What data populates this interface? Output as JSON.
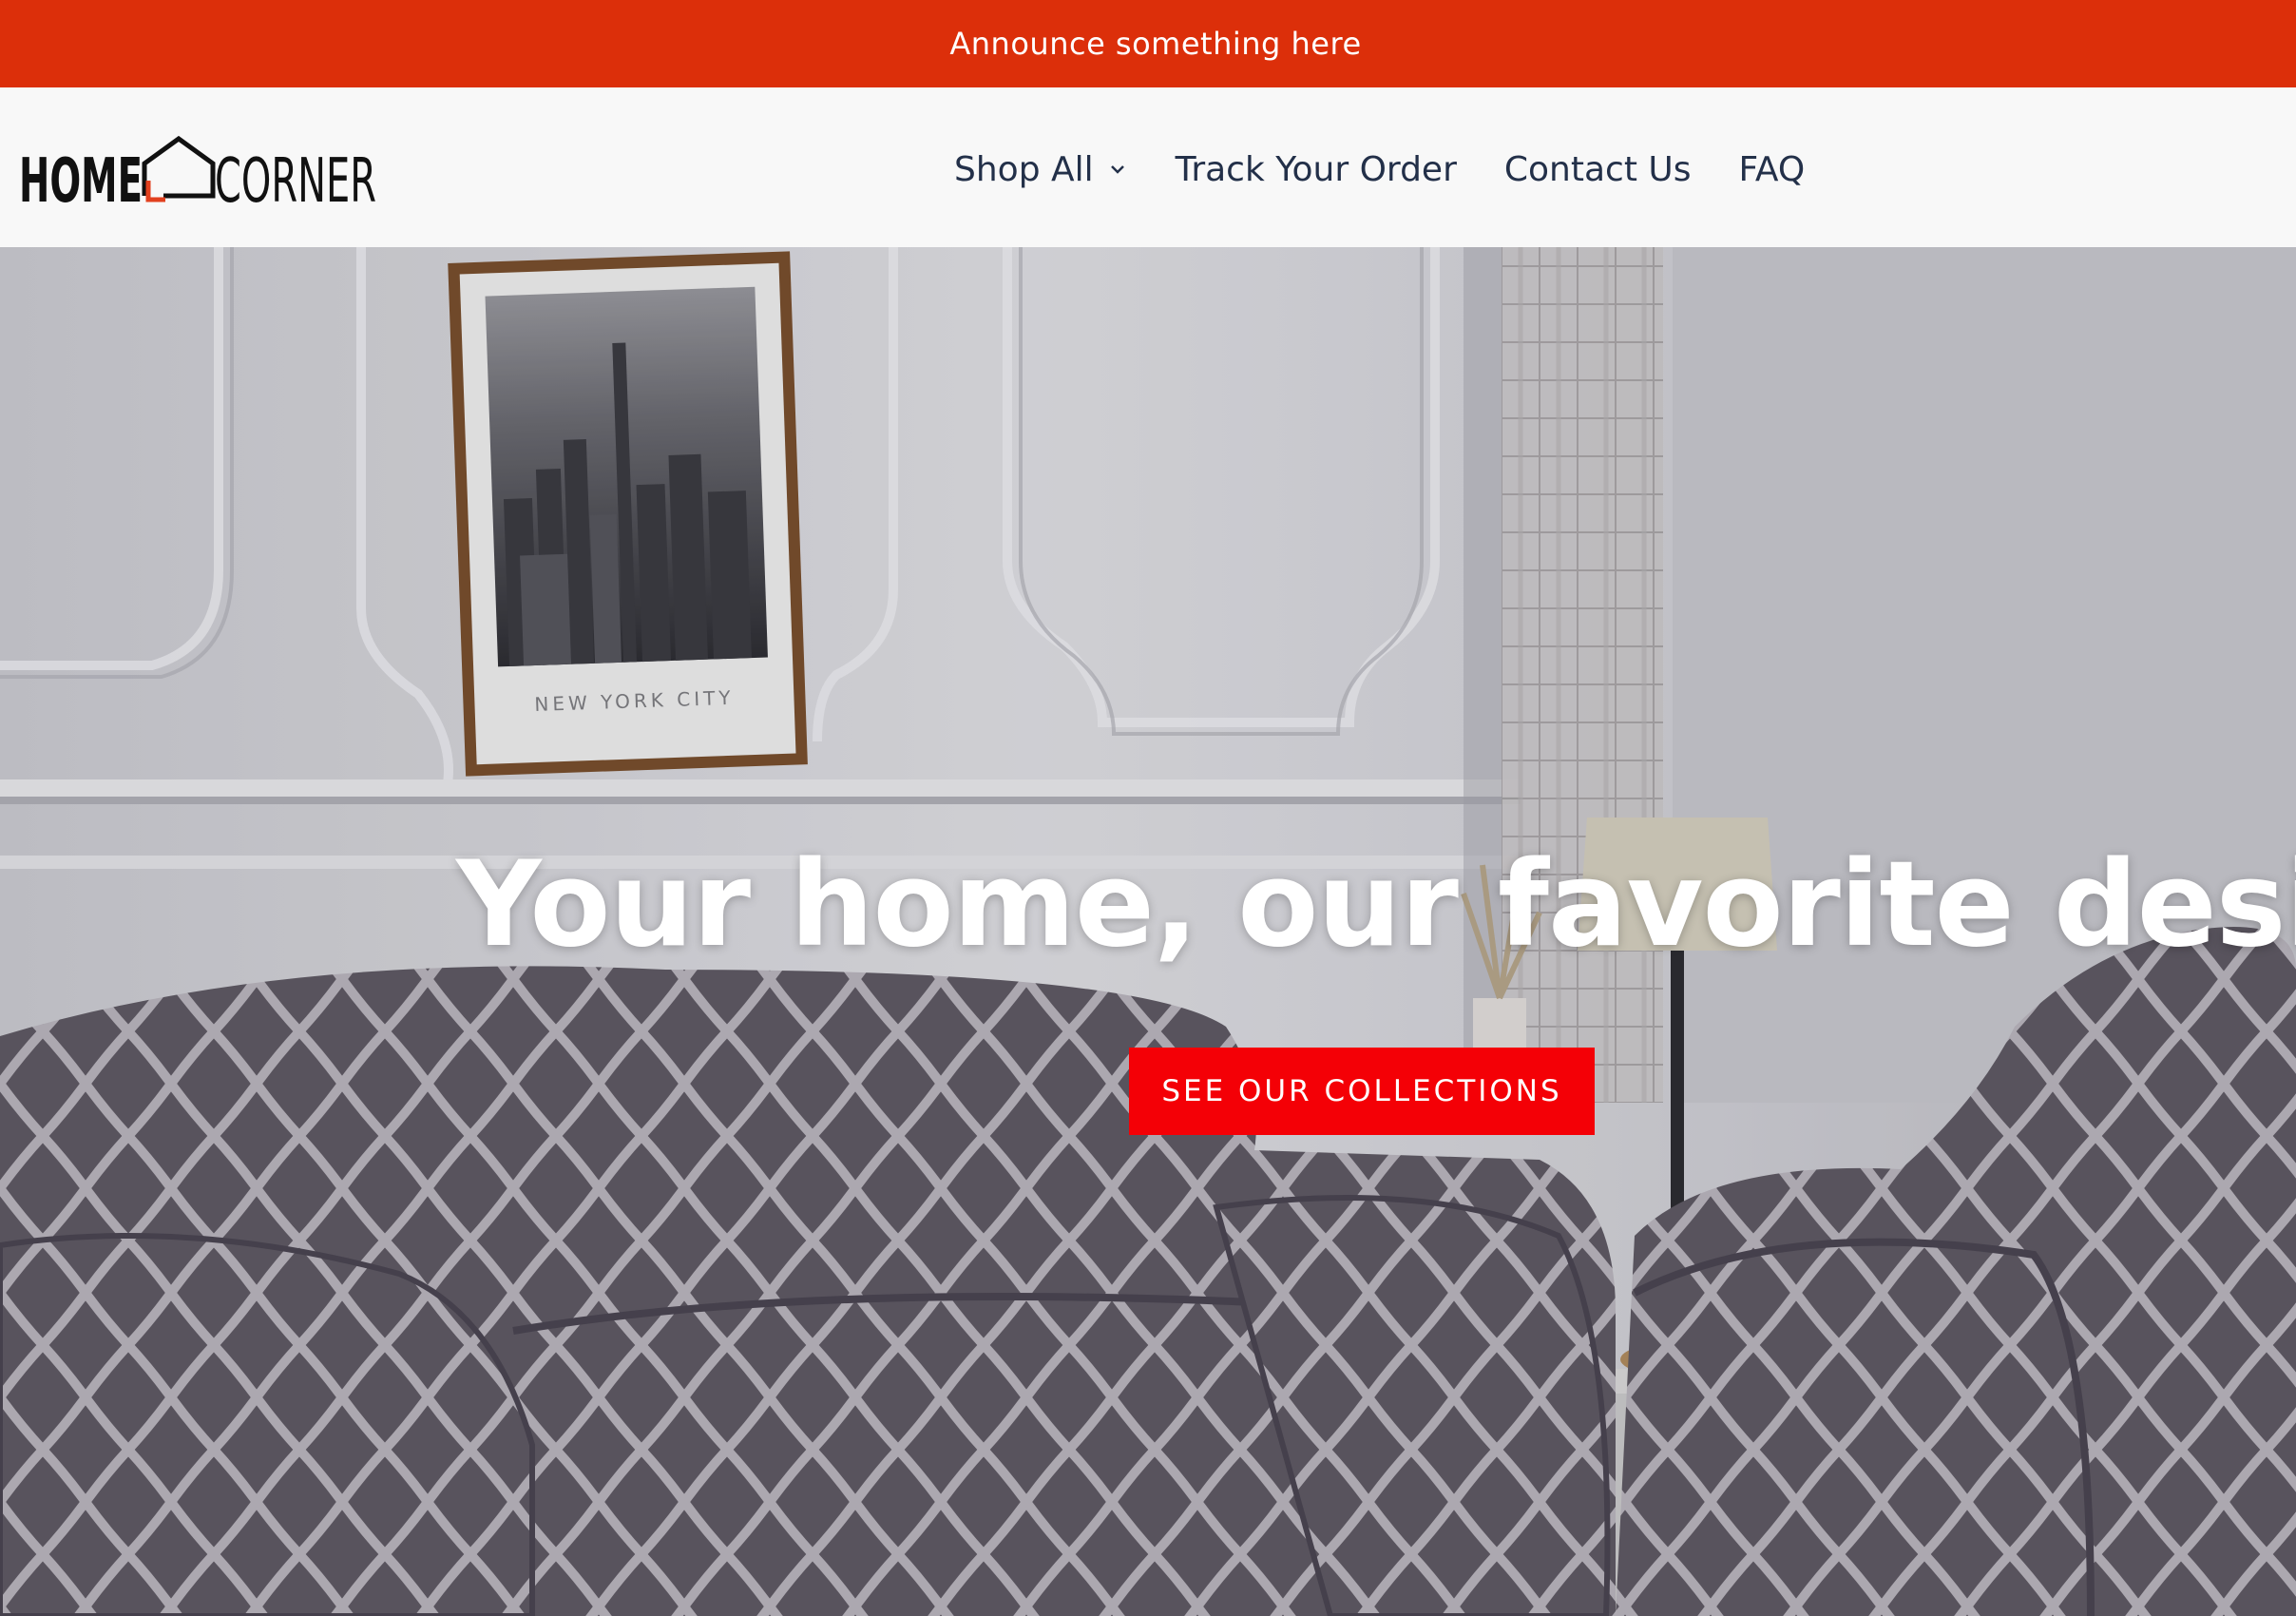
{
  "announcement": {
    "text": "Announce something here"
  },
  "header": {
    "logo": {
      "word_left": "HOME",
      "word_right": "CORNER"
    },
    "nav": [
      {
        "label": "Shop All",
        "has_dropdown": true,
        "icon": "chevron-down-icon"
      },
      {
        "label": "Track Your Order"
      },
      {
        "label": "Contact Us"
      },
      {
        "label": "FAQ"
      }
    ]
  },
  "hero": {
    "title": "Your home, our favorite design.",
    "cta_label": "SEE OUR COLLECTIONS",
    "poster_caption": "NEW YORK CITY"
  },
  "colors": {
    "announcement_bg": "#dc2f0a",
    "cta_bg": "#f40006",
    "nav_text": "#233049",
    "logo_accent": "#e2401e"
  }
}
